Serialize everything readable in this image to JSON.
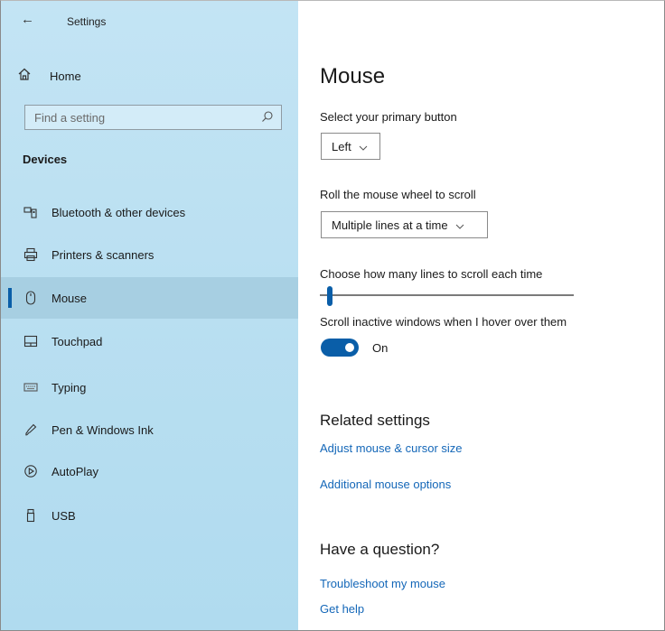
{
  "window": {
    "back_glyph": "←",
    "title": "Settings"
  },
  "sidebar": {
    "home_label": "Home",
    "search_placeholder": "Find a setting",
    "section_label": "Devices",
    "items": [
      {
        "label": "Bluetooth & other devices",
        "icon": "bluetooth-devices-icon"
      },
      {
        "label": "Printers & scanners",
        "icon": "printer-icon"
      },
      {
        "label": "Mouse",
        "icon": "mouse-icon",
        "active": true
      },
      {
        "label": "Touchpad",
        "icon": "touchpad-icon"
      },
      {
        "label": "Typing",
        "icon": "keyboard-icon"
      },
      {
        "label": "Pen & Windows Ink",
        "icon": "pen-icon"
      },
      {
        "label": "AutoPlay",
        "icon": "autoplay-icon"
      },
      {
        "label": "USB",
        "icon": "usb-icon"
      }
    ]
  },
  "main": {
    "title": "Mouse",
    "primary_button": {
      "label": "Select your primary button",
      "value": "Left"
    },
    "wheel": {
      "label": "Roll the mouse wheel to scroll",
      "value": "Multiple lines at a time"
    },
    "lines": {
      "label": "Choose how many lines to scroll each time",
      "level": 0.04
    },
    "inactive": {
      "label": "Scroll inactive windows when I hover over them",
      "state": "On"
    },
    "related": {
      "heading": "Related settings",
      "links": [
        "Adjust mouse & cursor size",
        "Additional mouse options"
      ]
    },
    "question": {
      "heading": "Have a question?",
      "links": [
        "Troubleshoot my mouse",
        "Get help"
      ]
    }
  },
  "colors": {
    "accent": "#0a5ea8",
    "link": "#1467b8",
    "sidebar_bg": "#bde1f3",
    "active_bg": "#a7cfe2"
  }
}
